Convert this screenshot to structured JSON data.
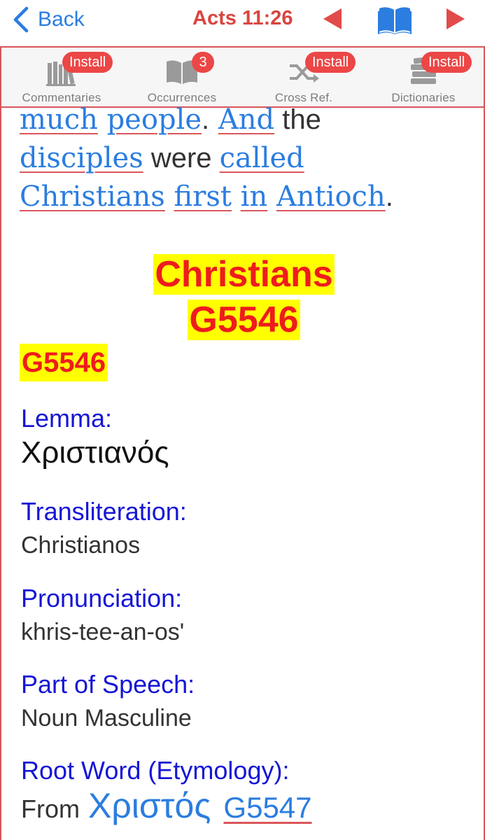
{
  "nav": {
    "back_label": "Back",
    "reference": "Acts 11:26"
  },
  "toolbar": {
    "tools": [
      {
        "label": "Commentaries",
        "badge": "Install",
        "icon": "books-icon"
      },
      {
        "label": "Occurrences",
        "badge": "3",
        "icon": "open-book-icon"
      },
      {
        "label": "Cross Ref.",
        "badge": "Install",
        "icon": "shuffle-icon"
      },
      {
        "label": "Dictionaries",
        "badge": "Install",
        "icon": "book-stack-icon"
      }
    ]
  },
  "verse": {
    "w1": "much",
    "w2": "people",
    "p1": ".",
    "w3": "And",
    "p2": " the",
    "w4": "disciples",
    "p3": " were ",
    "w5": "called",
    "w6": "Christians",
    "w7": "first",
    "w8": "in",
    "w9": "Antioch",
    "p4": "."
  },
  "entry": {
    "heading_word": "Christians",
    "heading_code": "G5546",
    "code": "G5546",
    "lemma_label": "Lemma:",
    "lemma": "Χριστιανός",
    "translit_label": "Transliteration:",
    "translit": "Christianos",
    "pron_label": "Pronunciation:",
    "pron": "khris-tee-an-os'",
    "pos_label": "Part of Speech:",
    "pos": "Noun Masculine",
    "root_label": "Root Word (Etymology):",
    "root_from": "From",
    "root_word": "Χριστός",
    "root_code": "G5547"
  },
  "colors": {
    "accent": "#2b7de0",
    "nav_red": "#d9453f",
    "badge_red": "#ec4646",
    "label_blue": "#1515d6",
    "highlight": "#ffff00",
    "heading_red": "#ee1c1c"
  }
}
